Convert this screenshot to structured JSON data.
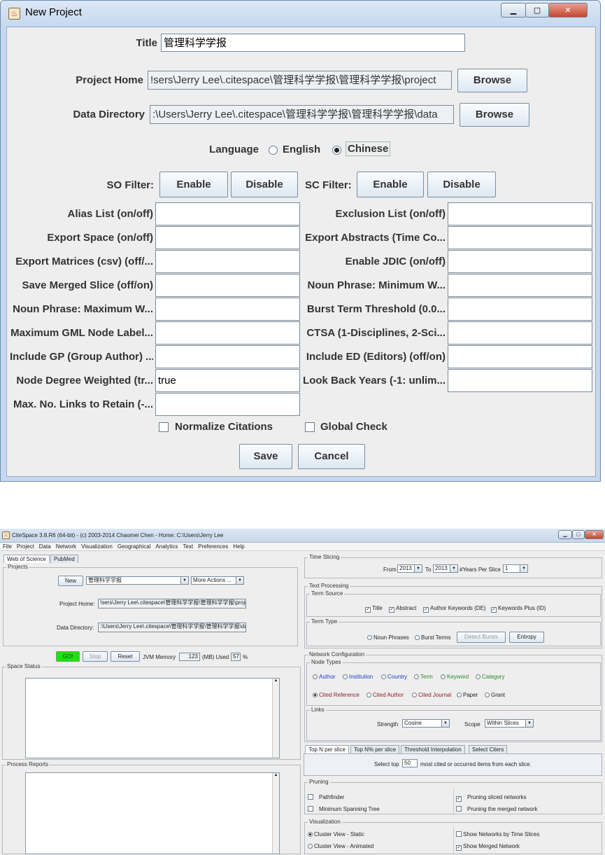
{
  "dialog": {
    "title": "New Project",
    "title_label": "Title",
    "title_value": "管理科学学报",
    "project_home_label": "Project Home",
    "project_home_value": "!sers\\Jerry Lee\\.citespace\\管理科学学报\\管理科学学报\\project",
    "data_dir_label": "Data Directory",
    "data_dir_value": ":\\Users\\Jerry Lee\\.citespace\\管理科学学报\\管理科学学报\\data",
    "browse": "Browse",
    "language_label": "Language",
    "lang_english": "English",
    "lang_chinese": "Chinese",
    "so_filter": "SO Filter:",
    "sc_filter": "SC Filter:",
    "enable": "Enable",
    "disable": "Disable",
    "fields_left": [
      {
        "label": "Alias List (on/off)",
        "value": ""
      },
      {
        "label": "Export Space (on/off)",
        "value": ""
      },
      {
        "label": "Export Matrices (csv) (off/...",
        "value": ""
      },
      {
        "label": "Save Merged Slice (off/on)",
        "value": ""
      },
      {
        "label": "Noun Phrase: Maximum W...",
        "value": ""
      },
      {
        "label": "Maximum GML Node Label...",
        "value": ""
      },
      {
        "label": "Include GP (Group Author) ...",
        "value": ""
      },
      {
        "label": "Node Degree Weighted (tr...",
        "value": "true"
      },
      {
        "label": "Max. No. Links to Retain (-...",
        "value": ""
      }
    ],
    "fields_right": [
      {
        "label": "Exclusion List (on/off)",
        "value": ""
      },
      {
        "label": "Export Abstracts (Time Co...",
        "value": ""
      },
      {
        "label": "Enable JDIC (on/off)",
        "value": ""
      },
      {
        "label": "Noun Phrase: Minimum W...",
        "value": ""
      },
      {
        "label": "Burst Term Threshold (0.0...",
        "value": ""
      },
      {
        "label": "CTSA (1-Disciplines, 2-Sci...",
        "value": ""
      },
      {
        "label": "Include ED (Editors) (off/on)",
        "value": ""
      },
      {
        "label": "Look Back Years (-1: unlim...",
        "value": ""
      }
    ],
    "normalize": "Normalize Citations",
    "global_check": "Global Check",
    "save": "Save",
    "cancel": "Cancel"
  },
  "cs": {
    "title": "CiteSpace 3.8.R6 (64-bit) - (c) 2003-2014 Chaomei Chen - Home: C:\\Users\\Jerry Lee",
    "menu": [
      "File",
      "Project",
      "Data",
      "Network",
      "Visualization",
      "Geographical",
      "Analytics",
      "Text",
      "Preferences",
      "Help"
    ],
    "tabs": [
      "Web of Science",
      "PubMed"
    ],
    "projects_group": "Projects",
    "new_btn": "New",
    "project_name": "管理科学学报",
    "more_actions": "More Actions ...",
    "project_home_label": "Project Home:",
    "project_home_value": "!sers\\Jerry Lee\\.citespace\\管理科学学报\\管理科学学报\\project",
    "data_dir_label": "Data Directory:",
    "data_dir_value": ":\\Users\\Jerry Lee\\.citespace\\管理科学学报\\管理科学学报\\data",
    "go": "GO!",
    "stop": "Stop",
    "reset": "Reset",
    "jvm_label": "JVM Memory",
    "jvm_value": "123",
    "mb_used": "(MB) Used",
    "pct_value": "57",
    "pct": "%",
    "space_status": "Space Status",
    "process_reports": "Process Reports",
    "time_slicing": "Time Slicing",
    "from": "From",
    "from_val": "2013",
    "to": "To",
    "to_val": "2013",
    "years_per_slice": "#Years Per Slice",
    "years_val": "1",
    "text_processing": "Text Processing",
    "term_source": "Term Source",
    "ts_title": "Title",
    "ts_abstract": "Abstract",
    "ts_author_kw": "Author Keywords (DE)",
    "ts_kw_plus": "Keywords Plus (ID)",
    "term_type": "Term Type",
    "noun_phrases": "Noun Phrases",
    "burst_terms": "Burst Terms",
    "detect_bursts": "Detect Bursts",
    "entropy": "Entropy",
    "network_config": "Network Configuration",
    "node_types": "Node Types",
    "nt_author": "Author",
    "nt_institution": "Institution",
    "nt_country": "Country",
    "nt_term": "Term",
    "nt_keyword": "Keyword",
    "nt_category": "Category",
    "nt_cited_ref": "Cited Reference",
    "nt_cited_author": "Cited Author",
    "nt_cited_journal": "Cited Journal",
    "nt_paper": "Paper",
    "nt_grant": "Grant",
    "links": "Links",
    "strength": "Strength",
    "strength_val": "Cosine",
    "scope": "Scope",
    "scope_val": "Within Slices",
    "sel_tabs": [
      "Top N per slice",
      "Top N% per slice",
      "Threshold Interpolation",
      "Select Citers"
    ],
    "select_top": "Select top",
    "top_val": "50",
    "most_cited": "most cited or occurred items from each slice.",
    "pruning": "Pruning",
    "pathfinder": "Pathfinder",
    "mst": "Minimum Spanning Tree",
    "prune_sliced": "Pruning sliced networks",
    "prune_merged": "Pruning the merged network",
    "visualization": "Visualization",
    "cv_static": "Cluster View - Static",
    "cv_animated": "Cluster View - Animated",
    "show_by_slices": "Show Networks by Time Slices",
    "show_merged": "Show Merged Network"
  }
}
